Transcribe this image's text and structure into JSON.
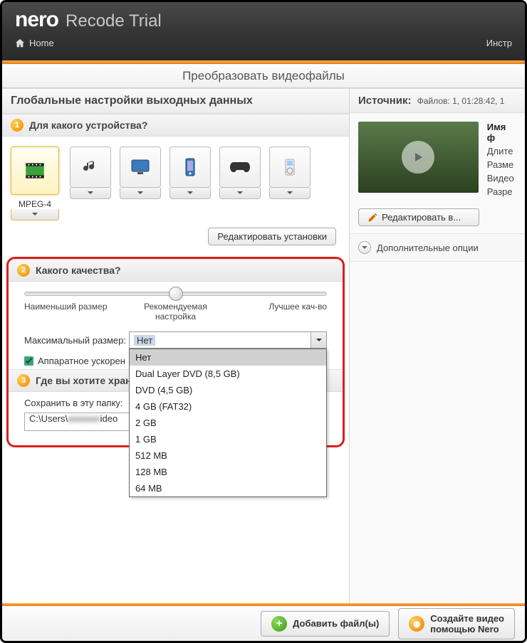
{
  "app": {
    "brand": "nero",
    "product": "Recode Trial"
  },
  "nav": {
    "home": "Home",
    "tools": "Инстр"
  },
  "tab_title": "Преобразовать видеофайлы",
  "left": {
    "global_title": "Глобальные настройки выходных данных",
    "step1": {
      "num": "1",
      "title": "Для какого устройства?",
      "selected_label": "MPEG-4",
      "edit_presets": "Редактировать установки"
    },
    "step2": {
      "num": "2",
      "title": "Какого качества?",
      "slider": {
        "min": "Наименьший размер",
        "mid": "Рекомендуемая настройка",
        "max": "Лучшее кач-во"
      },
      "max_size_label": "Максимальный размер:",
      "max_size_value": "Нет",
      "max_size_options": [
        "Нет",
        "Dual Layer DVD (8,5 GB)",
        "DVD (4,5 GB)",
        "4 GB (FAT32)",
        "2 GB",
        "1 GB",
        "512 MB",
        "128 MB",
        "64 MB"
      ],
      "hw_accel": "Аппаратное ускорен"
    },
    "step3": {
      "num": "3",
      "title": "Где вы хотите хран",
      "save_label": "Сохранить в эту папку:",
      "path_prefix": "C:\\Users\\",
      "path_suffix": "ideo"
    }
  },
  "right": {
    "source_label": "Источник:",
    "source_meta": "Файлов: 1, 01:28:42, 1",
    "meta": {
      "name": "Имя ф",
      "duration": "Длите",
      "size": "Разме",
      "video": "Видео",
      "res": "Разре"
    },
    "edit_video": "Редактировать в...",
    "adv_options": "Дополнительные опции"
  },
  "footer": {
    "add_files": "Добавить файл(ы)",
    "create_disc_l1": "Создайте видео",
    "create_disc_l2": "помощью Nero"
  }
}
